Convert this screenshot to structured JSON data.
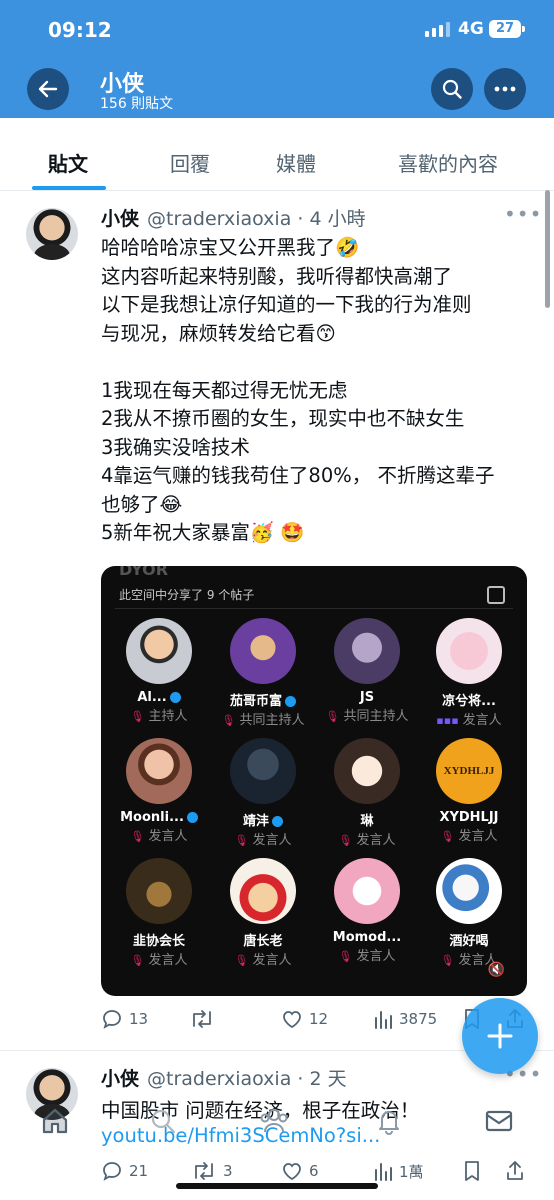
{
  "status_bar": {
    "time": "09:12",
    "network": "4G",
    "battery": "27"
  },
  "profile": {
    "name": "小侠",
    "post_count": "156 則貼文"
  },
  "tabs": [
    "貼文",
    "回覆",
    "媒體",
    "喜歡的內容"
  ],
  "active_tab": "貼文",
  "tweet1": {
    "name": "小侠",
    "handle_time": "@traderxiaoxia · 4 小時",
    "lines": [
      "哈哈哈哈凉宝又公开黑我了🤣",
      "这内容听起来特别酸，我听得都快高潮了",
      "以下是我想让凉仔知道的一下我的行为准则",
      "与现况，麻烦转发给它看😙",
      "",
      "1我现在每天都过得无忧无虑",
      "2我从不撩币圈的女生，现实中也不缺女生",
      "3我确实没啥技术",
      "4靠运气赚的钱我苟住了80%， 不折腾这辈子",
      "也够了😂",
      "5新年祝大家暴富🥳 🤩"
    ],
    "card": {
      "title": "DYOR",
      "shared_text": "此空间中分享了 9 个帖子",
      "people": [
        {
          "name": "Al...",
          "role": "主持人",
          "verified": true
        },
        {
          "name": "茄哥币富",
          "role": "共同主持人",
          "verified": true
        },
        {
          "name": "JS",
          "role": "共同主持人",
          "verified": false
        },
        {
          "name": "凉兮将...",
          "role": "发言人",
          "verified": false
        },
        {
          "name": "Moonli...",
          "role": "发言人",
          "verified": true
        },
        {
          "name": "靖沣",
          "role": "发言人",
          "verified": true
        },
        {
          "name": "琳",
          "role": "发言人",
          "verified": false
        },
        {
          "name": "XYDHLJJ",
          "role": "发言人",
          "verified": false
        },
        {
          "name": "韭协会长",
          "role": "发言人",
          "verified": false
        },
        {
          "name": "唐长老",
          "role": "发言人",
          "verified": false
        },
        {
          "name": "Momod...",
          "role": "发言人",
          "verified": false
        },
        {
          "name": "酒好喝",
          "role": "发言人",
          "verified": false
        }
      ],
      "xydh_avatar_text": "XYDHLJJ"
    },
    "stats": {
      "replies": "13",
      "retweets": "",
      "likes": "12",
      "views": "3875"
    }
  },
  "tweet2": {
    "name": "小侠",
    "handle_time": "@traderxiaoxia · 2 天",
    "text": "中国股市 问题在经济，根子在政治！",
    "link": "youtu.be/Hfmi3SCemNo?si...",
    "stats": {
      "replies": "21",
      "retweets": "3",
      "likes": "6",
      "views": "1萬"
    }
  },
  "colors": {
    "accent": "#1d9bf0",
    "header_bg": "#3d92e0"
  }
}
